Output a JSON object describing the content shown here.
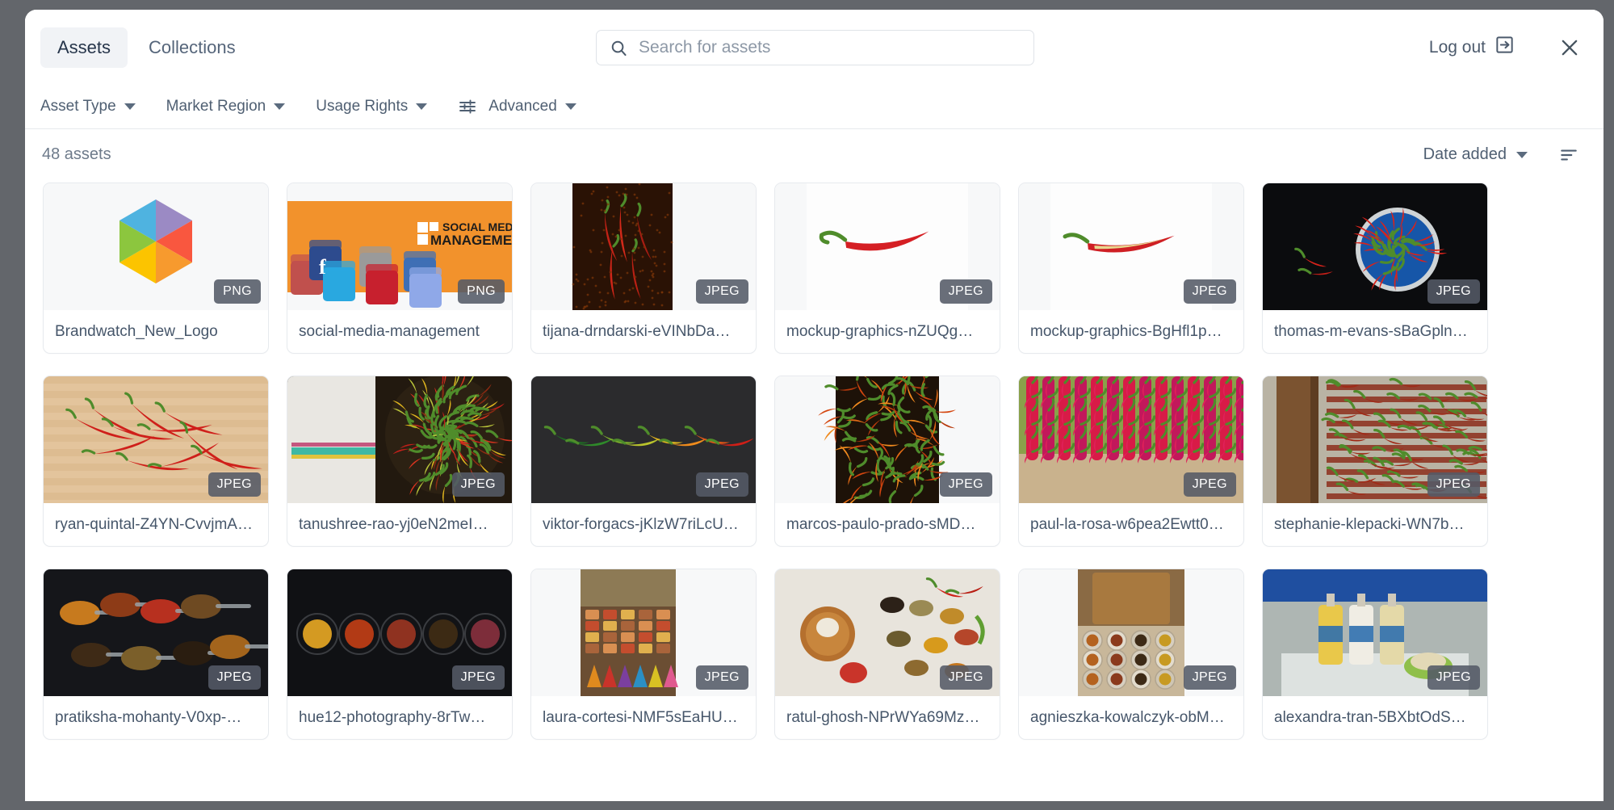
{
  "header": {
    "tabs": [
      {
        "label": "Assets",
        "active": true
      },
      {
        "label": "Collections",
        "active": false
      }
    ],
    "search": {
      "placeholder": "Search for assets",
      "value": "",
      "icon": "search-icon"
    },
    "logout_label": "Log out",
    "logout_icon": "logout-arrow-icon",
    "close_icon": "close-icon"
  },
  "filters": [
    {
      "label": "Asset Type",
      "icon": "chevron-down-icon"
    },
    {
      "label": "Market Region",
      "icon": "chevron-down-icon"
    },
    {
      "label": "Usage Rights",
      "icon": "chevron-down-icon"
    },
    {
      "label": "Advanced",
      "icon": "sliders-icon"
    }
  ],
  "results": {
    "count_text": "48 assets",
    "sort_label": "Date added",
    "sort_icon": "chevron-down-icon",
    "sort_direction_icon": "sort-descending-icon"
  },
  "colors": {
    "backdrop": "#63666b",
    "panel": "#ffffff",
    "tab_active_bg": "#f1f3f6",
    "text_primary": "#2b3d52",
    "text_muted": "#6d7a8a",
    "badge_bg": "rgba(84,90,102,0.88)",
    "card_border": "#e7eaee"
  },
  "assets": [
    {
      "name": "Brandwatch_New_Logo",
      "format": "PNG",
      "art": "brandwatch-logo"
    },
    {
      "name": "social-media-management",
      "format": "PNG",
      "art": "social-media-banner"
    },
    {
      "name": "tijana-drndarski-eVINbDa…",
      "format": "JPEG",
      "art": "chilies-dark-portrait"
    },
    {
      "name": "mockup-graphics-nZUQg…",
      "format": "JPEG",
      "art": "single-red-chili-white"
    },
    {
      "name": "mockup-graphics-BgHfl1p…",
      "format": "JPEG",
      "art": "sliced-red-chili-white"
    },
    {
      "name": "thomas-m-evans-sBaGpln…",
      "format": "JPEG",
      "art": "blue-bowl-chilies-black"
    },
    {
      "name": "ryan-quintal-Z4YN-CvvjmA…",
      "format": "JPEG",
      "art": "red-chilies-wood-board"
    },
    {
      "name": "tanushree-rao-yj0eN2meI…",
      "format": "JPEG",
      "art": "chilies-bowl-cloth"
    },
    {
      "name": "viktor-forgacs-jKlzW7riLcU…",
      "format": "JPEG",
      "art": "chili-gradient-row-dark"
    },
    {
      "name": "marcos-paulo-prado-sMD…",
      "format": "JPEG",
      "art": "orange-chilies-portrait"
    },
    {
      "name": "paul-la-rosa-w6pea2Ewtt0…",
      "format": "JPEG",
      "art": "hanging-chili-strings"
    },
    {
      "name": "stephanie-klepacki-WN7b…",
      "format": "JPEG",
      "art": "drying-chilies-pillar"
    },
    {
      "name": "pratiksha-mohanty-V0xp-…",
      "format": "JPEG",
      "art": "spice-spoons-dark"
    },
    {
      "name": "hue12-photography-8rTw…",
      "format": "JPEG",
      "art": "spice-bowls-row-dark"
    },
    {
      "name": "laura-cortesi-NMF5sEaHU…",
      "format": "JPEG",
      "art": "spice-market-stall"
    },
    {
      "name": "ratul-ghosh-NPrWYa69Mz…",
      "format": "JPEG",
      "art": "spices-flatlay-wood"
    },
    {
      "name": "agnieszka-kowalczyk-obM…",
      "format": "JPEG",
      "art": "spice-bowls-table"
    },
    {
      "name": "alexandra-tran-5BXbtOdS…",
      "format": "JPEG",
      "art": "sauce-bottles-market"
    }
  ]
}
